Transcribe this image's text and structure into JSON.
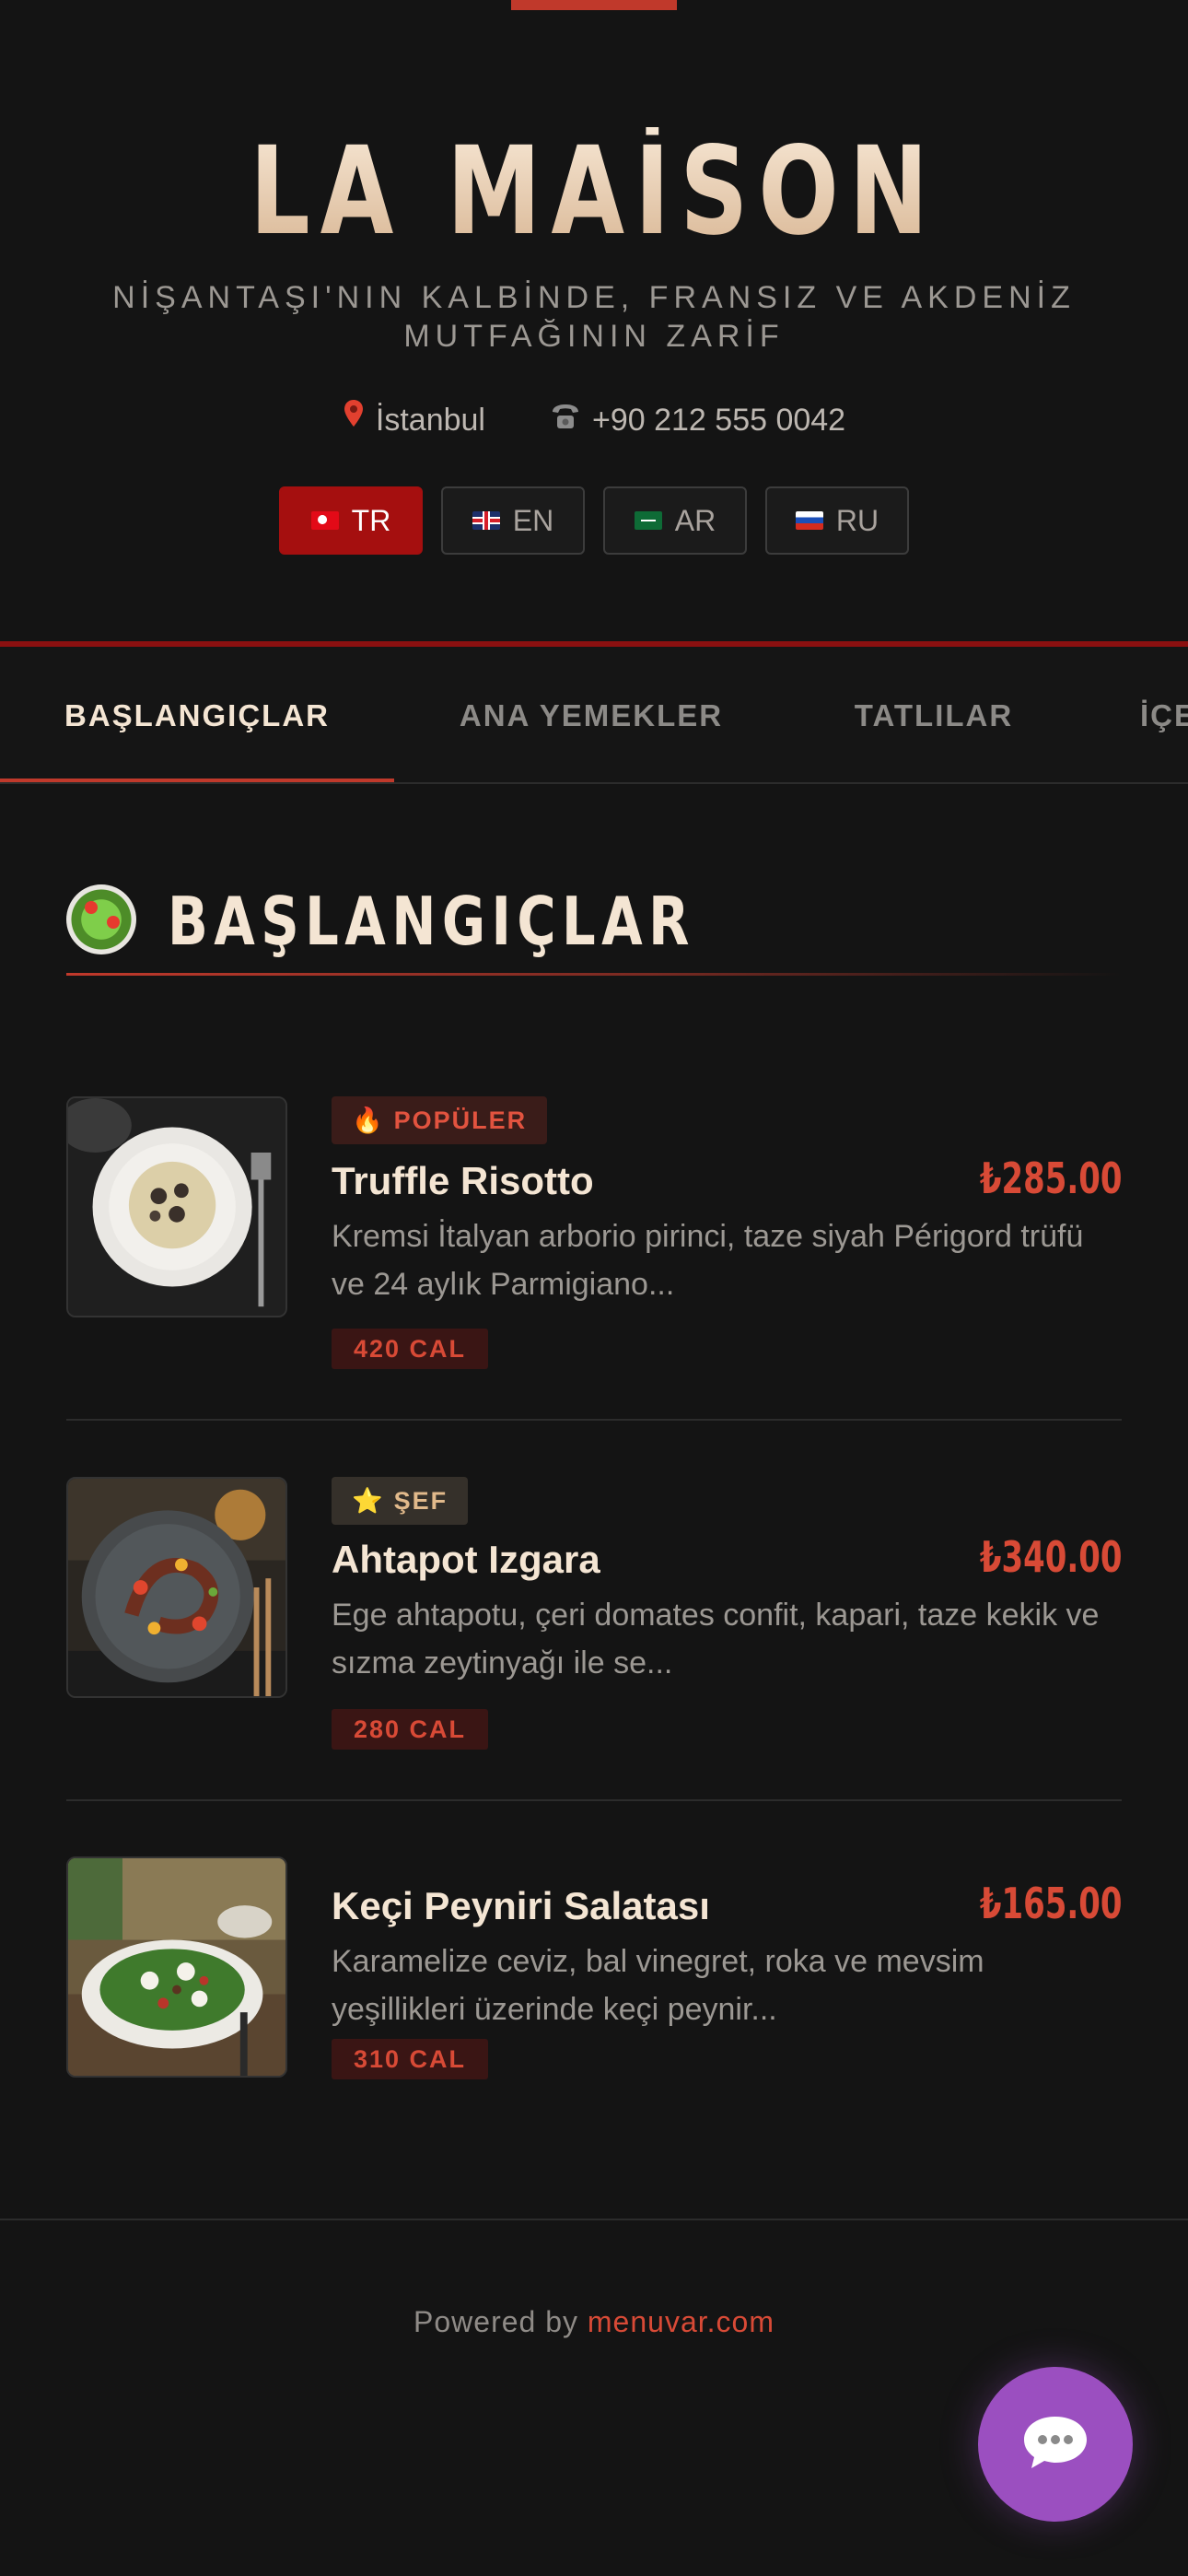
{
  "restaurant": {
    "name": "LA MAİSON",
    "tagline": "NİŞANTAŞI'NIN KALBİNDE, FRANSIZ VE AKDENİZ MUTFAĞININ ZARİF",
    "location": "İstanbul",
    "phone": "+90 212 555 0042",
    "location_icon": "map-pin-icon",
    "phone_icon": "telephone-icon"
  },
  "languages": [
    {
      "code": "TR",
      "flag": "flag-turkey-icon",
      "active": true
    },
    {
      "code": "EN",
      "flag": "flag-uk-icon",
      "active": false
    },
    {
      "code": "AR",
      "flag": "flag-saudi-icon",
      "active": false
    },
    {
      "code": "RU",
      "flag": "flag-russia-icon",
      "active": false
    }
  ],
  "categories": [
    {
      "label": "BAŞLANGIÇLAR",
      "active": true
    },
    {
      "label": "ANA YEMEKLER",
      "active": false
    },
    {
      "label": "TATLILAR",
      "active": false
    },
    {
      "label": "İÇECEKLER",
      "active": false
    }
  ],
  "section": {
    "title": "BAŞLANGIÇLAR",
    "icon": "salad-icon"
  },
  "items": [
    {
      "badge": "POPÜLER",
      "badge_icon": "fire-icon",
      "name": "Truffle Risotto",
      "price": "₺285.00",
      "description": "Kremsi İtalyan arborio pirinci, taze siyah Périgord trüfü ve 24 aylık Parmigiano...",
      "calories": "420 CAL"
    },
    {
      "badge": "ŞEF",
      "badge_icon": "star-icon",
      "name": "Ahtapot Izgara",
      "price": "₺340.00",
      "description": "Ege ahtapotu, çeri domates confit, kapari, taze kekik ve sızma zeytinyağı ile se...",
      "calories": "280 CAL"
    },
    {
      "badge": "",
      "name": "Keçi Peyniri Salatası",
      "price": "₺165.00",
      "description": "Karamelize ceviz, bal vinegret, roka ve mevsim yeşillikleri üzerinde keçi peynir...",
      "calories": "310 CAL"
    }
  ],
  "footer": {
    "powered_by": "Powered by",
    "link": "menuvar.com"
  },
  "chat": {
    "icon": "chat-bubble-icon"
  },
  "colors": {
    "background": "#141414",
    "accent": "#c0392b",
    "active_lang": "#a50f0f",
    "price": "#d84a36",
    "chat_button": "#9b4fc0"
  }
}
